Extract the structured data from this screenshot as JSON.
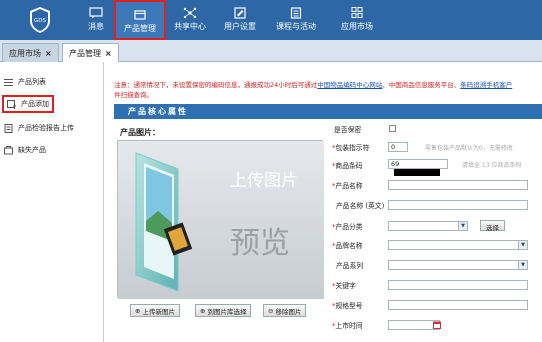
{
  "nav": {
    "items": [
      {
        "label": "消息",
        "icon": "message-icon"
      },
      {
        "label": "产品管理",
        "icon": "product-icon"
      },
      {
        "label": "共享中心",
        "icon": "share-icon"
      },
      {
        "label": "用户设置",
        "icon": "settings-icon"
      },
      {
        "label": "课程与活动",
        "icon": "course-icon"
      },
      {
        "label": "应用市场",
        "icon": "apps-icon"
      }
    ],
    "logo_text": "GDS"
  },
  "tabs": [
    {
      "label": "应用市场"
    },
    {
      "label": "产品管理"
    }
  ],
  "sidebar": {
    "items": [
      {
        "label": "产品列表"
      },
      {
        "label": "产品添加"
      },
      {
        "label": "产品检验报告上传"
      },
      {
        "label": "缺失产品"
      }
    ]
  },
  "notice": {
    "text_a": "注意：通常情况下，未设置保密的编码信息，通报成功24小时后可通过",
    "link1": "中国物品编码中心网站",
    "text_b": "、中国商品信息服务平台、",
    "link2": "条码追溯手机客户",
    "text_c": "件扫描查询。"
  },
  "section": {
    "title": "产品核心属性"
  },
  "image_panel": {
    "title": "产品图片：",
    "upload_line": "上传图片",
    "preview_line": "预览",
    "buttons": [
      "上传新图片",
      "到图片库选择",
      "移除图片"
    ]
  },
  "form": {
    "confidential": "是否保密",
    "packaging": "包装指示符",
    "packaging_value": "0",
    "packaging_hint": "零售包装产品默认为0，无需修改",
    "barcode": "商品条码",
    "barcode_value": "69",
    "barcode_hint": "请填全 13 位商品条码",
    "name": "产品名称",
    "name_en": "产品名称 (英文)",
    "category": "产品分类",
    "select_btn": "选择",
    "brand": "品牌名称",
    "series": "产品系列",
    "keywords": "关键字",
    "model": "规格型号",
    "launch": "上市时间"
  }
}
